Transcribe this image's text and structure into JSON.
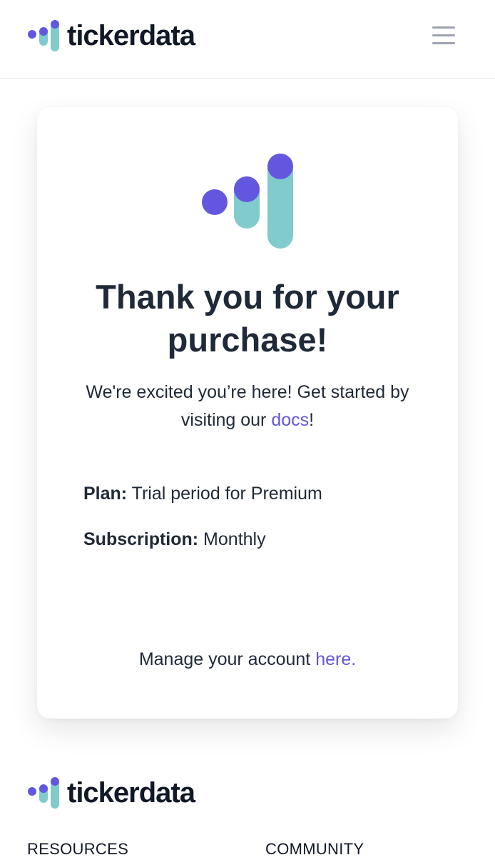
{
  "header": {
    "brand": "tickerdata",
    "menu_icon": "hamburger-menu-icon"
  },
  "colors": {
    "accent": "#6358d6",
    "teal": "#82cbcc",
    "purple_dot": "#6357e0",
    "text": "#1f2937"
  },
  "card": {
    "logo_icon": "tickerdata-logo-icon",
    "title": "Thank you for your purchase!",
    "intro_text": "We're excited you’re here! Get started by visiting our ",
    "docs_link": "docs",
    "intro_end": "!",
    "plan_label": "Plan:",
    "plan_value": " Trial period for Premium",
    "subscription_label": "Subscription:",
    "subscription_value": " Monthly",
    "manage_text": "Manage your account ",
    "manage_link": "here."
  },
  "footer": {
    "brand": "tickerdata",
    "resources_heading": "RESOURCES",
    "community_heading": "COMMUNITY"
  }
}
